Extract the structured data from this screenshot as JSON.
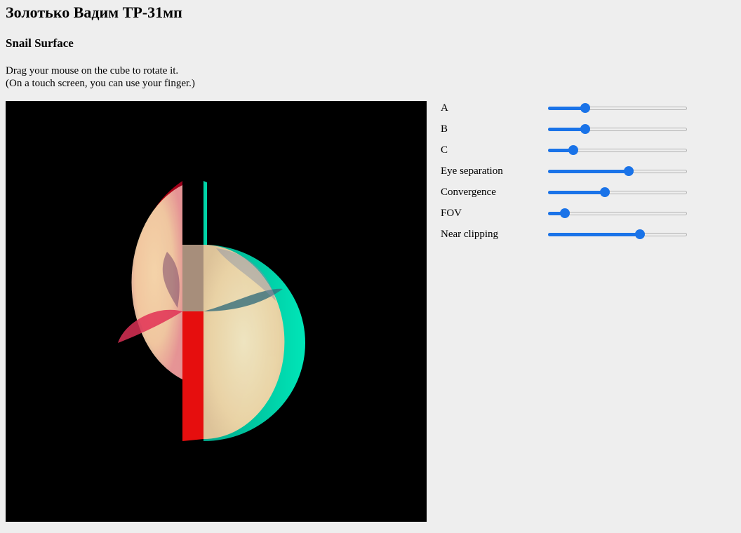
{
  "header": {
    "title": "Золотько Вадим ТР-31мп",
    "subtitle": "Snail Surface"
  },
  "instructions": {
    "line1": "Drag your mouse on the cube to rotate it.",
    "line2": "(On a touch screen, you can use your finger.)"
  },
  "viewport": {
    "background": "#000000",
    "anaglyph_left_color": "#ff0000",
    "anaglyph_right_color": "#00e6b8"
  },
  "controls": [
    {
      "label": "A",
      "value": 0.27
    },
    {
      "label": "B",
      "value": 0.27
    },
    {
      "label": "C",
      "value": 0.18
    },
    {
      "label": "Eye separation",
      "value": 0.58
    },
    {
      "label": "Convergence",
      "value": 0.41
    },
    {
      "label": "FOV",
      "value": 0.12
    },
    {
      "label": "Near clipping",
      "value": 0.66
    }
  ],
  "accent_color": "#1a73e8"
}
